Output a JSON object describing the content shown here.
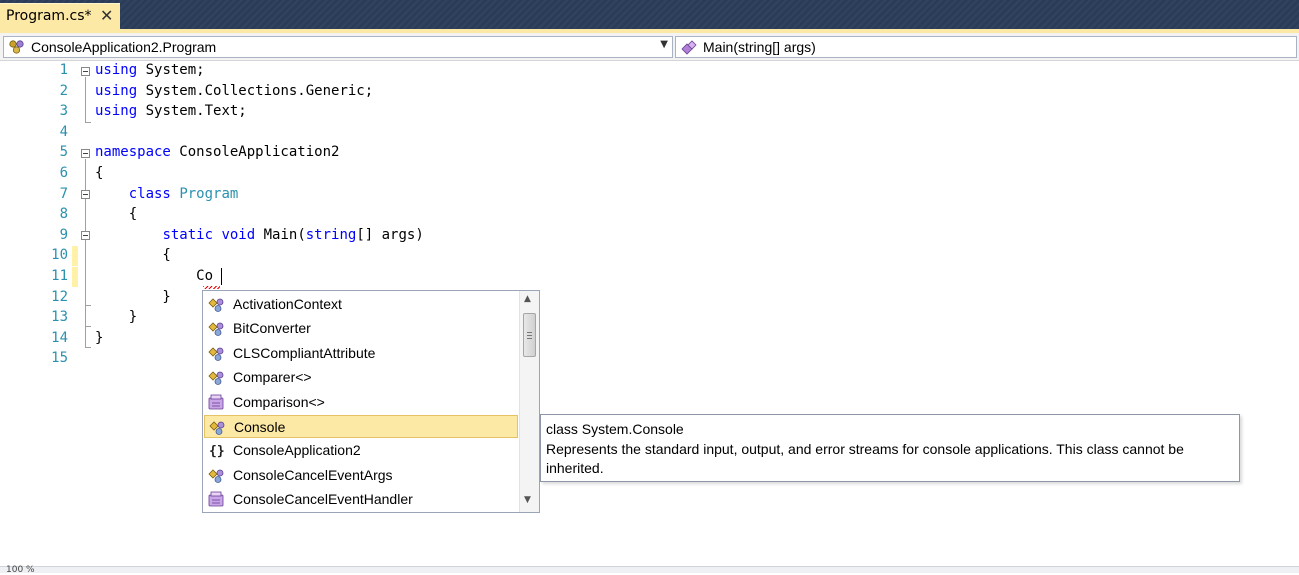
{
  "tab": {
    "title": "Program.cs*",
    "close_glyph": "✕"
  },
  "navbar": {
    "type_combo": "ConsoleApplication2.Program",
    "member_combo": "Main(string[] args)",
    "type_icon": "class-icon",
    "member_icon": "method-icon"
  },
  "editor": {
    "lines": [
      {
        "n": "1",
        "tokens": [
          [
            "kw",
            "using"
          ],
          [
            "",
            " System;"
          ]
        ]
      },
      {
        "n": "2",
        "tokens": [
          [
            "kw",
            "using"
          ],
          [
            "",
            " System.Collections.Generic;"
          ]
        ]
      },
      {
        "n": "3",
        "tokens": [
          [
            "kw",
            "using"
          ],
          [
            "",
            " System.Text;"
          ]
        ]
      },
      {
        "n": "4",
        "tokens": []
      },
      {
        "n": "5",
        "tokens": [
          [
            "kw",
            "namespace"
          ],
          [
            "",
            " ConsoleApplication2"
          ]
        ]
      },
      {
        "n": "6",
        "tokens": [
          [
            "",
            "{"
          ]
        ]
      },
      {
        "n": "7",
        "tokens": [
          [
            "",
            "    "
          ],
          [
            "kw",
            "class"
          ],
          [
            "",
            " "
          ],
          [
            "ty",
            "Program"
          ]
        ]
      },
      {
        "n": "8",
        "tokens": [
          [
            "",
            "    {"
          ]
        ]
      },
      {
        "n": "9",
        "tokens": [
          [
            "",
            "        "
          ],
          [
            "kw",
            "static"
          ],
          [
            "",
            " "
          ],
          [
            "kw",
            "void"
          ],
          [
            "",
            " Main("
          ],
          [
            "kw",
            "string"
          ],
          [
            "",
            "[] args)"
          ]
        ]
      },
      {
        "n": "10",
        "tokens": [
          [
            "",
            "        {"
          ]
        ]
      },
      {
        "n": "11",
        "tokens": [
          [
            "",
            "            Co"
          ]
        ]
      },
      {
        "n": "12",
        "tokens": [
          [
            "",
            "        }"
          ]
        ]
      },
      {
        "n": "13",
        "tokens": [
          [
            "",
            "    }"
          ]
        ]
      },
      {
        "n": "14",
        "tokens": [
          [
            "",
            "}"
          ]
        ]
      },
      {
        "n": "15",
        "tokens": []
      }
    ]
  },
  "completion": {
    "selected_index": 5,
    "items": [
      {
        "label": "ActivationContext",
        "icon": "class-icon"
      },
      {
        "label": "BitConverter",
        "icon": "class-icon"
      },
      {
        "label": "CLSCompliantAttribute",
        "icon": "class-icon"
      },
      {
        "label": "Comparer<>",
        "icon": "class-icon"
      },
      {
        "label": "Comparison<>",
        "icon": "delegate-icon"
      },
      {
        "label": "Console",
        "icon": "class-icon"
      },
      {
        "label": "ConsoleApplication2",
        "icon": "namespace-icon"
      },
      {
        "label": "ConsoleCancelEventArgs",
        "icon": "class-icon"
      },
      {
        "label": "ConsoleCancelEventHandler",
        "icon": "delegate-icon"
      }
    ]
  },
  "tooltip": {
    "signature": "class System.Console",
    "description": "Represents the standard input, output, and error streams for console applications. This class cannot be inherited."
  },
  "status": {
    "zoom": "100 %"
  }
}
